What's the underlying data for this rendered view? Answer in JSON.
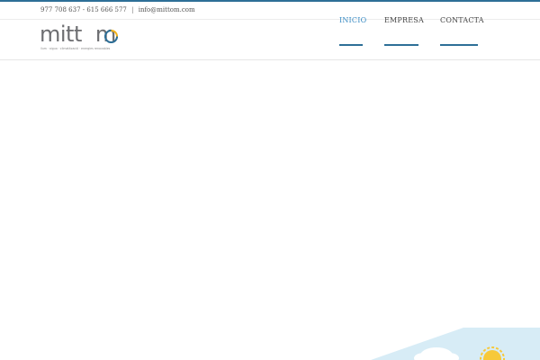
{
  "topbar": {
    "phones": "977 708 637 - 615 666 577",
    "separator": "|",
    "email": "info@mittom.com"
  },
  "logo": {
    "name_start": "mitt",
    "name_end": "m",
    "tagline": "llum · aigua · climatització · energies renovables"
  },
  "nav": {
    "items": [
      {
        "label": "INICIO",
        "active": true
      },
      {
        "label": "EMPRESA",
        "active": false
      },
      {
        "label": "CONTACTA",
        "active": false
      }
    ]
  },
  "colors": {
    "accent": "#2e6f97",
    "active_nav": "#3b8cc4",
    "sky": "#d7ecf6",
    "sun": "#f7c93a",
    "logo_blue": "#2e6f97",
    "logo_gold": "#f2b31c"
  }
}
